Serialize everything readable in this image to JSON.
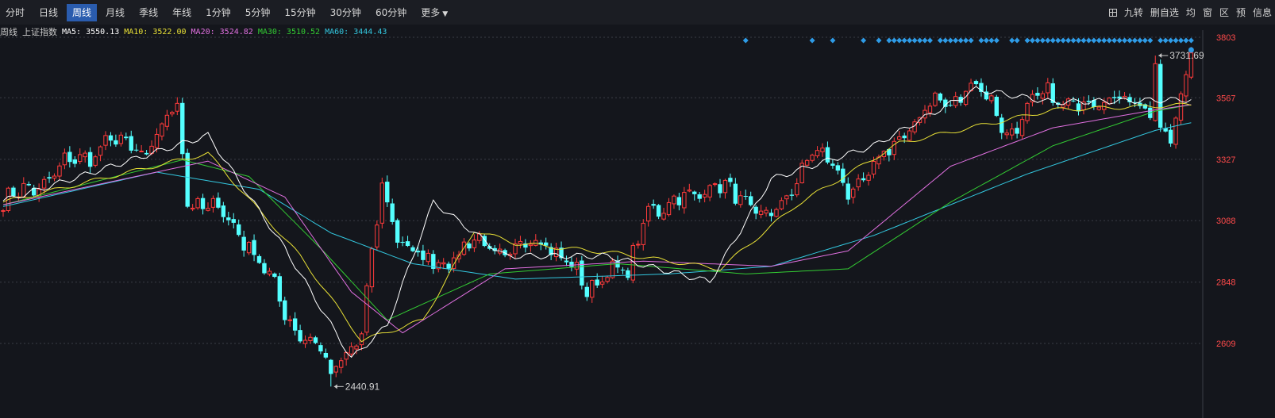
{
  "toolbar": {
    "tabs": [
      {
        "label": "分时",
        "active": false
      },
      {
        "label": "日线",
        "active": false
      },
      {
        "label": "周线",
        "active": true
      },
      {
        "label": "月线",
        "active": false
      },
      {
        "label": "季线",
        "active": false
      },
      {
        "label": "年线",
        "active": false
      },
      {
        "label": "1分钟",
        "active": false
      },
      {
        "label": "5分钟",
        "active": false
      },
      {
        "label": "15分钟",
        "active": false
      },
      {
        "label": "30分钟",
        "active": false
      },
      {
        "label": "60分钟",
        "active": false
      }
    ],
    "more_label": "更多",
    "tools": [
      {
        "icon": "grid-icon",
        "label": ""
      },
      {
        "label": "九转"
      },
      {
        "label": "删自选"
      },
      {
        "label": "均"
      },
      {
        "label": "窗"
      },
      {
        "label": "区"
      },
      {
        "label": "预"
      },
      {
        "label": "信息"
      }
    ]
  },
  "legend": {
    "period": "周线",
    "index_name": "上证指数",
    "ma": [
      {
        "label": "MA5: 3550.13",
        "color": "#ffffff"
      },
      {
        "label": "MA10: 3522.00",
        "color": "#e8e036"
      },
      {
        "label": "MA20: 3524.82",
        "color": "#e070e0"
      },
      {
        "label": "MA30: 3510.52",
        "color": "#33cc33"
      },
      {
        "label": "MA60: 3444.43",
        "color": "#33c8e0"
      }
    ]
  },
  "chart_data": {
    "type": "candlestick",
    "title": "上证指数 周线",
    "y_ticks": [
      3803,
      3567,
      3327,
      3088,
      2848,
      2609
    ],
    "ylim": [
      2440,
      3850
    ],
    "colors": {
      "up": "#ff3b3b",
      "down": "#54ffff",
      "tick_label": "#ff4a4a",
      "signal": "#2e9be6"
    },
    "high_annotation": {
      "label": "3731.69",
      "value": 3731.69,
      "bar_index": 225
    },
    "low_annotation": {
      "label": "2440.91",
      "value": 2440.91,
      "bar_index": 64
    },
    "close_anchors": [
      [
        0,
        3150
      ],
      [
        10,
        3270
      ],
      [
        20,
        3390
      ],
      [
        28,
        3360
      ],
      [
        34,
        3530
      ],
      [
        36,
        3180
      ],
      [
        42,
        3120
      ],
      [
        48,
        3010
      ],
      [
        55,
        2730
      ],
      [
        60,
        2620
      ],
      [
        64,
        2510
      ],
      [
        70,
        2650
      ],
      [
        74,
        3210
      ],
      [
        77,
        3050
      ],
      [
        82,
        2910
      ],
      [
        86,
        2940
      ],
      [
        92,
        3000
      ],
      [
        98,
        2960
      ],
      [
        106,
        3020
      ],
      [
        110,
        2930
      ],
      [
        114,
        2800
      ],
      [
        118,
        2920
      ],
      [
        122,
        2860
      ],
      [
        126,
        3150
      ],
      [
        130,
        3150
      ],
      [
        134,
        3170
      ],
      [
        138,
        3250
      ],
      [
        143,
        3170
      ],
      [
        148,
        3130
      ],
      [
        152,
        3110
      ],
      [
        158,
        3390
      ],
      [
        165,
        3200
      ],
      [
        172,
        3330
      ],
      [
        180,
        3530
      ],
      [
        185,
        3540
      ],
      [
        189,
        3640
      ],
      [
        196,
        3440
      ],
      [
        204,
        3580
      ],
      [
        212,
        3530
      ],
      [
        218,
        3600
      ],
      [
        224,
        3470
      ],
      [
        228,
        3430
      ],
      [
        232,
        3720
      ]
    ],
    "ma_anchors": {
      "MA60": [
        [
          0,
          3143
        ],
        [
          30,
          3277
        ],
        [
          50,
          3210
        ],
        [
          64,
          3040
        ],
        [
          80,
          2920
        ],
        [
          100,
          2860
        ],
        [
          130,
          2880
        ],
        [
          150,
          2910
        ],
        [
          170,
          3030
        ],
        [
          200,
          3270
        ],
        [
          225,
          3440
        ],
        [
          232,
          3470
        ]
      ],
      "MA30": [
        [
          0,
          3150
        ],
        [
          35,
          3325
        ],
        [
          48,
          3260
        ],
        [
          62,
          2980
        ],
        [
          75,
          2700
        ],
        [
          95,
          2880
        ],
        [
          120,
          2920
        ],
        [
          145,
          2880
        ],
        [
          165,
          2900
        ],
        [
          185,
          3160
        ],
        [
          205,
          3380
        ],
        [
          225,
          3515
        ],
        [
          232,
          3540
        ]
      ],
      "MA20": [
        [
          0,
          3150
        ],
        [
          40,
          3320
        ],
        [
          55,
          3180
        ],
        [
          68,
          2810
        ],
        [
          78,
          2650
        ],
        [
          98,
          2900
        ],
        [
          125,
          2930
        ],
        [
          150,
          2910
        ],
        [
          165,
          2970
        ],
        [
          185,
          3300
        ],
        [
          205,
          3450
        ],
        [
          225,
          3520
        ],
        [
          232,
          3540
        ]
      ],
      "MA10": [
        [
          0,
          3160
        ],
        [
          40,
          3350
        ],
        [
          58,
          2950
        ],
        [
          70,
          2620
        ],
        [
          82,
          2700
        ],
        [
          92,
          3050
        ],
        [
          100,
          3000
        ],
        [
          120,
          2960
        ],
        [
          140,
          2900
        ],
        [
          155,
          3150
        ],
        [
          175,
          3390
        ],
        [
          205,
          3520
        ],
        [
          232,
          3540
        ]
      ],
      "MA5": [
        [
          0,
          3165
        ],
        [
          40,
          3420
        ],
        [
          55,
          2980
        ],
        [
          68,
          2550
        ],
        [
          75,
          2680
        ],
        [
          84,
          3160
        ],
        [
          98,
          2950
        ],
        [
          118,
          2950
        ],
        [
          138,
          2850
        ],
        [
          150,
          3250
        ],
        [
          170,
          3380
        ],
        [
          190,
          3600
        ],
        [
          205,
          3550
        ],
        [
          232,
          3560
        ]
      ]
    },
    "signal_markers": [
      145,
      158,
      162,
      168,
      171,
      173,
      174,
      175,
      176,
      177,
      178,
      179,
      180,
      181,
      183,
      184,
      185,
      186,
      187,
      188,
      189,
      191,
      192,
      193,
      194,
      197,
      198,
      200,
      201,
      202,
      203,
      204,
      205,
      206,
      207,
      208,
      209,
      210,
      211,
      212,
      213,
      214,
      215,
      216,
      217,
      218,
      219,
      220,
      221,
      222,
      223,
      224,
      226,
      227,
      228,
      229,
      230,
      231,
      232
    ]
  }
}
